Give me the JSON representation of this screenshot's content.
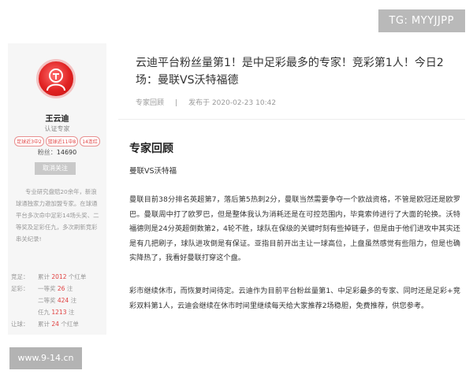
{
  "watermark_top": "TG: MYYJJPP",
  "watermark_bottom": "www.9-14.cn",
  "profile": {
    "name": "王云迪",
    "role": "认证专家",
    "tags": [
      "足球近3中2",
      "篮球近11中8",
      "14连红"
    ],
    "fans_label": "粉丝：",
    "fans_count": "14690",
    "unfollow_label": "取消关注",
    "bio": "专业研究盘赔20余年，新浪球通独家力邀加盟专家。在球通平台多次命中足彩14场头奖、二等奖及足彩任九，多次刷新竞彩串关纪录!",
    "records": [
      {
        "category": "竞足：",
        "prefix": "累计",
        "value": "2012",
        "suffix": "个红单"
      },
      {
        "category": "足彩：",
        "prefix": "一等奖",
        "value": "26",
        "suffix": "注"
      },
      {
        "category": "",
        "prefix": "二等奖",
        "value": "424",
        "suffix": "注"
      },
      {
        "category": "",
        "prefix": "任九",
        "value": "1213",
        "suffix": "注"
      },
      {
        "category": "让球：",
        "prefix": "累计",
        "value": "24",
        "suffix": "个红单"
      }
    ]
  },
  "article": {
    "title": "云迪平台粉丝量第1！是中足彩最多的专家！竞彩第1人！今日2场：曼联VS沃特福德",
    "category": "专家回顾",
    "separator": "|",
    "publish_label": "发布于",
    "publish_time": "2020-02-23 10:42",
    "section_heading": "专家回顾",
    "match": "曼联VS沃特福",
    "paragraph_1": "曼联目前38分排名英超第7，落后第5热刺2分，曼联当然需要争夺一个欧战资格，不管是欧冠还是欧罗巴。曼联周中打了欧罗巴，但是整体我认为消耗还是在可控范围内，毕竟索帅进行了大面的轮换。沃特福德则是24分英超倒数第2，4轮不胜，球队在保级的关键时刻有些掉链子，但是由于他们进攻中其实还是有几把刷子，球队进攻倒是有保证。亚指目前开出主让一球高位，上盘虽然感觉有些阻力，但是也确实降热了，我看好曼联打穿这个盘。",
    "paragraph_2": "彩市继续休市，而恢复时间待定。云迪作为目前平台粉丝量第1、中足彩最多的专家、同时还是足彩+竞彩双料第1人，云迪会继续在休市时间里继续每天给大家推荐2场稳胆，免费推荐，供您参考。"
  },
  "colors": {
    "accent_red": "#e04040",
    "avatar_red": "#e02222",
    "muted_text": "#999999",
    "sidebar_bg": "#f6f6f6",
    "watermark_bg": "#b9b9b9"
  }
}
